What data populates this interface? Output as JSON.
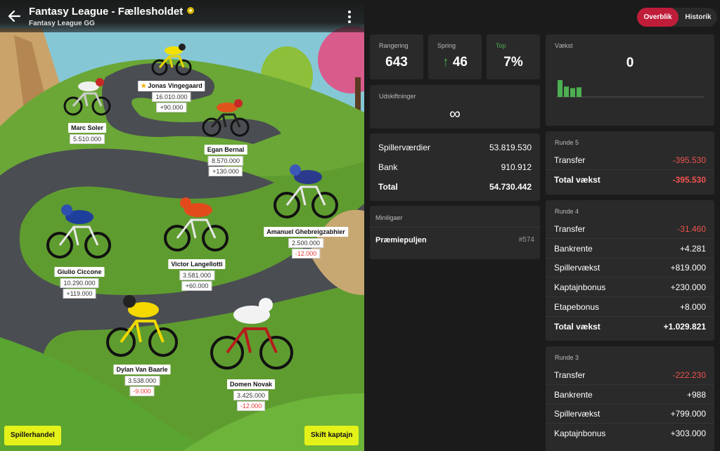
{
  "header": {
    "title": "Fantasy League - Fællesholdet",
    "subtitle": "Fantasy League GG"
  },
  "riders": [
    {
      "name": "Jonas Vingegaard",
      "value": "16.010.000",
      "change": "+90.000",
      "captain": true
    },
    {
      "name": "Marc Soler",
      "value": "5.510.000",
      "change": ""
    },
    {
      "name": "Egan Bernal",
      "value": "8.570.000",
      "change": "+130.000"
    },
    {
      "name": "Amanuel Ghebreigzabhier",
      "value": "2.500.000",
      "change": "-12.000"
    },
    {
      "name": "Giulio Ciccone",
      "value": "10.290.000",
      "change": "+119.000"
    },
    {
      "name": "Victor Langellotti",
      "value": "3.581.000",
      "change": "+60.000"
    },
    {
      "name": "Dylan Van Baarle",
      "value": "3.538.000",
      "change": "-9.000"
    },
    {
      "name": "Domen Novak",
      "value": "3.425.000",
      "change": "-12.000"
    }
  ],
  "buttons": {
    "trade": "Spillerhandel",
    "captain": "Skift kaptajn"
  },
  "tabs": {
    "overview": "Overblik",
    "history": "Historik"
  },
  "stats": {
    "rank_label": "Rangering",
    "rank": "643",
    "jump_label": "Spring",
    "jump": "46",
    "top_label": "Top",
    "top": "7%"
  },
  "swaps": {
    "label": "Udskiftninger",
    "value": "∞"
  },
  "values": {
    "players_label": "Spillerværdier",
    "players": "53.819.530",
    "bank_label": "Bank",
    "bank": "910.912",
    "total_label": "Total",
    "total": "54.730.442"
  },
  "minileagues": {
    "label": "Miniligaer",
    "name": "Præmiepuljen",
    "rank": "#574"
  },
  "growth": {
    "label": "Vækst",
    "value": "0",
    "bars": [
      21,
      13,
      11,
      12
    ]
  },
  "rounds": [
    {
      "title": "Runde 5",
      "rows": [
        {
          "label": "Transfer",
          "value": "-395.530",
          "neg": true
        },
        {
          "label": "Total vækst",
          "value": "-395.530",
          "neg": true,
          "bold": true
        }
      ]
    },
    {
      "title": "Runde 4",
      "rows": [
        {
          "label": "Transfer",
          "value": "-31.460",
          "neg": true
        },
        {
          "label": "Bankrente",
          "value": "+4.281"
        },
        {
          "label": "Spillervækst",
          "value": "+819.000"
        },
        {
          "label": "Kaptajnbonus",
          "value": "+230.000"
        },
        {
          "label": "Etapebonus",
          "value": "+8.000"
        },
        {
          "label": "Total vækst",
          "value": "+1.029.821",
          "bold": true
        }
      ]
    },
    {
      "title": "Runde 3",
      "rows": [
        {
          "label": "Transfer",
          "value": "-222.230",
          "neg": true
        },
        {
          "label": "Bankrente",
          "value": "+988"
        },
        {
          "label": "Spillervækst",
          "value": "+799.000"
        },
        {
          "label": "Kaptajnbonus",
          "value": "+303.000"
        }
      ]
    }
  ],
  "colors": {
    "accent": "#c01d3a",
    "button": "#e4f21a",
    "positive": "#4caf50",
    "negative": "#ef5350"
  }
}
